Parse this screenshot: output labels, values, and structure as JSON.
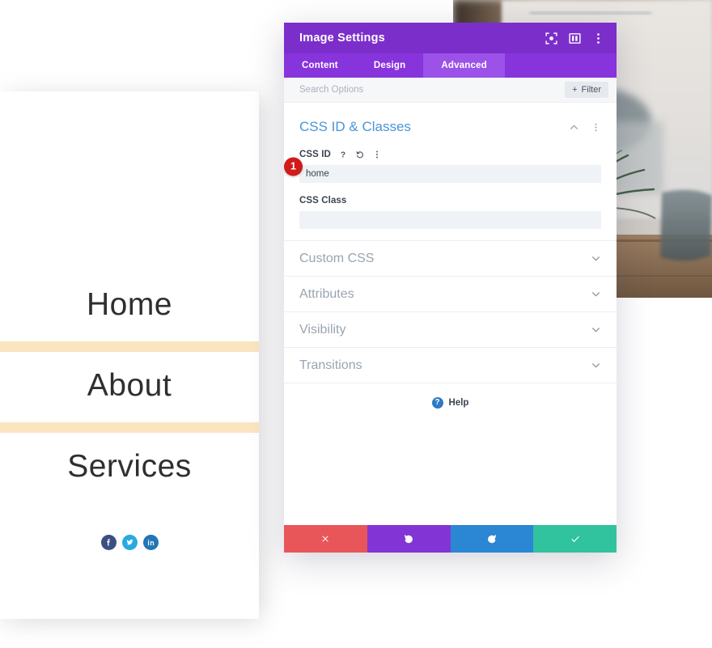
{
  "website_preview": {
    "nav_items": [
      {
        "label": "Home"
      },
      {
        "label": "About"
      },
      {
        "label": "Services"
      }
    ],
    "divider_color": "#fbe5c0",
    "socials": [
      {
        "name": "facebook",
        "color": "#3b4f81"
      },
      {
        "name": "twitter",
        "color": "#2aa9e0"
      },
      {
        "name": "linkedin",
        "color": "#2176b5"
      }
    ]
  },
  "modal": {
    "title": "Image Settings",
    "header_icons": [
      {
        "name": "focus-target-icon"
      },
      {
        "name": "layout-columns-icon"
      },
      {
        "name": "kebab-menu-icon"
      }
    ],
    "accent_purple": "#7c2ecb",
    "tabs": [
      {
        "label": "Content",
        "active": false
      },
      {
        "label": "Design",
        "active": false
      },
      {
        "label": "Advanced",
        "active": true
      }
    ],
    "search": {
      "placeholder": "Search Options",
      "value": ""
    },
    "filter_button": {
      "label": "Filter",
      "plus": "+"
    },
    "open_section": {
      "title": "CSS ID & Classes",
      "title_color": "#4a94d8",
      "fields": [
        {
          "label": "CSS ID",
          "value": "home",
          "placeholder": "",
          "badge": "1",
          "badge_color": "#d11a1a",
          "icons": [
            "help-icon",
            "reset-icon",
            "kebab-menu-icon"
          ]
        },
        {
          "label": "CSS Class",
          "value": "",
          "placeholder": "",
          "badge": "",
          "icons": []
        }
      ]
    },
    "collapsed_sections": [
      {
        "label": "Custom CSS"
      },
      {
        "label": "Attributes"
      },
      {
        "label": "Visibility"
      },
      {
        "label": "Transitions"
      }
    ],
    "help": {
      "icon_glyph": "?",
      "label": "Help"
    },
    "footer_buttons": [
      {
        "name": "close",
        "icon": "x-icon",
        "color": "#e8565a"
      },
      {
        "name": "undo",
        "icon": "undo-icon",
        "color": "#8334d4"
      },
      {
        "name": "redo",
        "icon": "redo-icon",
        "color": "#2b86d4"
      },
      {
        "name": "save",
        "icon": "checkmark-icon",
        "color": "#30c39e"
      }
    ]
  }
}
